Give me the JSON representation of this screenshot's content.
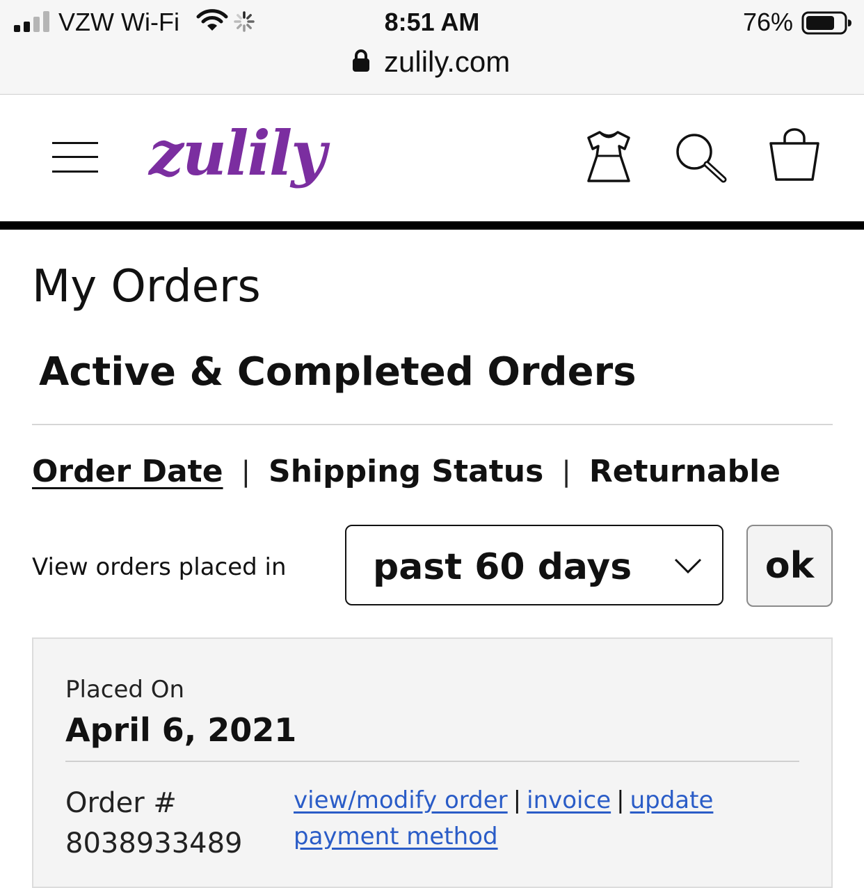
{
  "status_bar": {
    "carrier": "VZW Wi-Fi",
    "time": "8:51 AM",
    "battery_percent": "76%",
    "battery_level": 0.76,
    "signal_bars": 2
  },
  "browser": {
    "domain": "zulily.com"
  },
  "header": {
    "logo_text": "zulily",
    "brand_color": "#7b2ea0",
    "icons": [
      "menu-icon",
      "dress-icon",
      "search-icon",
      "shopping-bag-icon"
    ]
  },
  "page": {
    "title": "My Orders",
    "section_title": "Active & Completed Orders"
  },
  "tabs": [
    {
      "label": "Order Date",
      "active": true
    },
    {
      "label": "Shipping Status",
      "active": false
    },
    {
      "label": "Returnable",
      "active": false
    }
  ],
  "tab_separator": "|",
  "filter": {
    "label": "View orders placed in",
    "selected": "past 60 days",
    "ok_label": "ok"
  },
  "order": {
    "placed_label": "Placed On",
    "placed_date": "April 6, 2021",
    "order_label": "Order #",
    "order_number": "8038933489",
    "links": {
      "view_modify": "view/modify order",
      "invoice": "invoice",
      "update_payment": "update payment method"
    },
    "link_color": "#2a5cc7"
  }
}
